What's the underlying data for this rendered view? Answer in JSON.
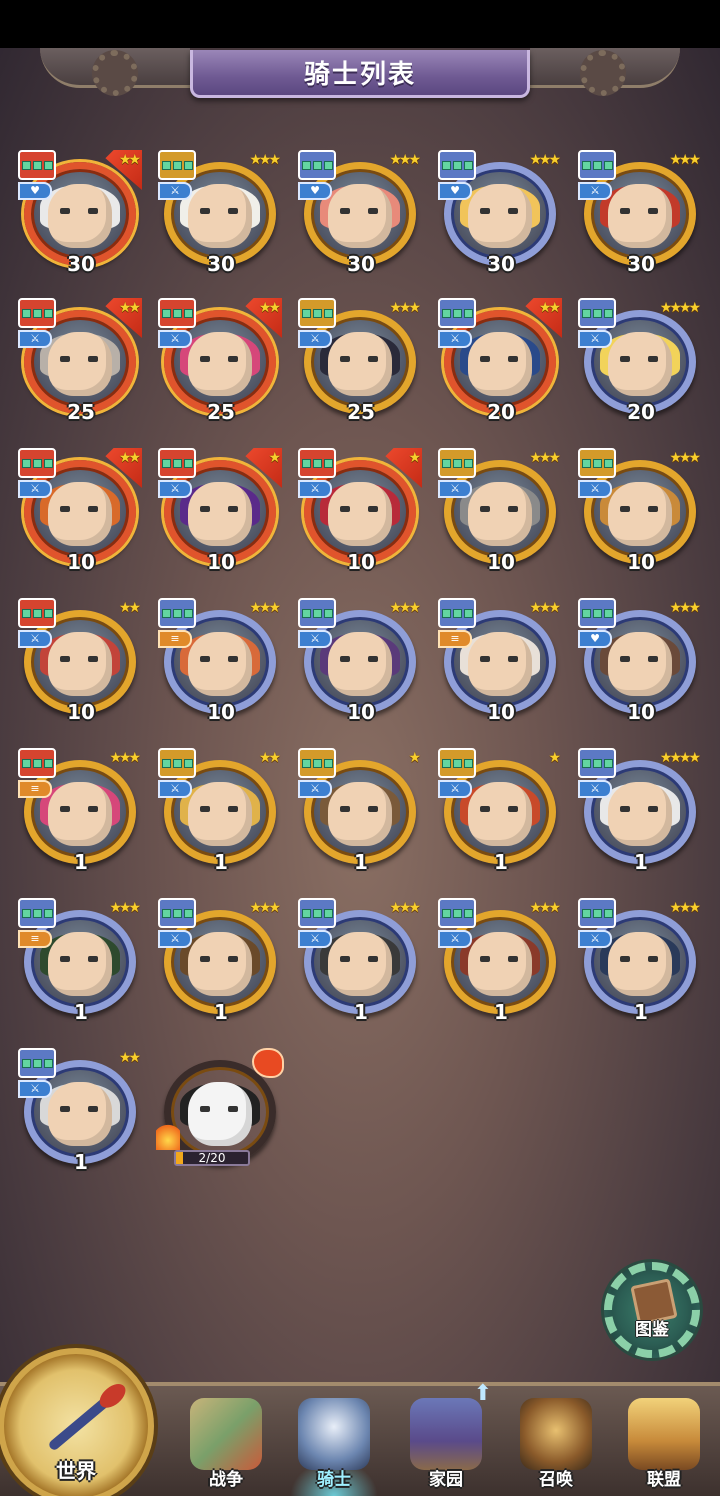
{
  "title": "骑士列表",
  "heroes": [
    {
      "level": "30",
      "frame": "red",
      "stars": 2,
      "class_color": "red",
      "role": "heart"
    },
    {
      "level": "30",
      "frame": "gold",
      "stars": 3,
      "class_color": "gold",
      "role": "sword"
    },
    {
      "level": "30",
      "frame": "gold",
      "stars": 3,
      "class_color": "blue",
      "role": "heart"
    },
    {
      "level": "30",
      "frame": "blue",
      "stars": 3,
      "class_color": "blue",
      "role": "heart"
    },
    {
      "level": "30",
      "frame": "gold",
      "stars": 3,
      "class_color": "blue",
      "role": "sword"
    },
    {
      "level": "25",
      "frame": "red",
      "stars": 2,
      "class_color": "red",
      "role": "sword"
    },
    {
      "level": "25",
      "frame": "red",
      "stars": 2,
      "class_color": "red",
      "role": "sword"
    },
    {
      "level": "25",
      "frame": "gold",
      "stars": 3,
      "class_color": "gold",
      "role": "sword"
    },
    {
      "level": "20",
      "frame": "red",
      "stars": 2,
      "class_color": "blue",
      "role": "sword"
    },
    {
      "level": "20",
      "frame": "blue",
      "stars": 4,
      "class_color": "blue",
      "role": "sword"
    },
    {
      "level": "10",
      "frame": "red",
      "stars": 2,
      "class_color": "red",
      "role": "sword"
    },
    {
      "level": "10",
      "frame": "red",
      "stars": 1,
      "class_color": "red",
      "role": "sword"
    },
    {
      "level": "10",
      "frame": "red",
      "stars": 1,
      "class_color": "red",
      "role": "sword"
    },
    {
      "level": "10",
      "frame": "gold",
      "stars": 3,
      "class_color": "gold",
      "role": "sword"
    },
    {
      "level": "10",
      "frame": "gold",
      "stars": 3,
      "class_color": "gold",
      "role": "sword"
    },
    {
      "level": "10",
      "frame": "gold",
      "stars": 2,
      "class_color": "red",
      "role": "sword"
    },
    {
      "level": "10",
      "frame": "blue",
      "stars": 3,
      "class_color": "blue",
      "role": "bars"
    },
    {
      "level": "10",
      "frame": "blue",
      "stars": 3,
      "class_color": "blue",
      "role": "sword"
    },
    {
      "level": "10",
      "frame": "blue",
      "stars": 3,
      "class_color": "blue",
      "role": "bars"
    },
    {
      "level": "10",
      "frame": "blue",
      "stars": 3,
      "class_color": "blue",
      "role": "heart"
    },
    {
      "level": "1",
      "frame": "gold",
      "stars": 3,
      "class_color": "red",
      "role": "bars"
    },
    {
      "level": "1",
      "frame": "gold",
      "stars": 2,
      "class_color": "gold",
      "role": "sword"
    },
    {
      "level": "1",
      "frame": "gold",
      "stars": 1,
      "class_color": "gold",
      "role": "sword"
    },
    {
      "level": "1",
      "frame": "gold",
      "stars": 1,
      "class_color": "gold",
      "role": "sword"
    },
    {
      "level": "1",
      "frame": "blue",
      "stars": 4,
      "class_color": "blue",
      "role": "sword"
    },
    {
      "level": "1",
      "frame": "blue",
      "stars": 3,
      "class_color": "blue",
      "role": "bars"
    },
    {
      "level": "1",
      "frame": "gold",
      "stars": 3,
      "class_color": "blue",
      "role": "sword"
    },
    {
      "level": "1",
      "frame": "blue",
      "stars": 3,
      "class_color": "blue",
      "role": "sword"
    },
    {
      "level": "1",
      "frame": "gold",
      "stars": 3,
      "class_color": "blue",
      "role": "sword"
    },
    {
      "level": "1",
      "frame": "blue",
      "stars": 3,
      "class_color": "blue",
      "role": "sword"
    },
    {
      "level": "1",
      "frame": "blue",
      "stars": 2,
      "class_color": "blue",
      "role": "sword"
    }
  ],
  "shard_hero": {
    "progress_text": "2/20",
    "progress": 0.1
  },
  "codex_label": "图鉴",
  "nav": {
    "world": "世界",
    "battle": "战争",
    "knights": "骑士",
    "home": "家园",
    "summon": "召唤",
    "alliance": "联盟"
  },
  "colors": {
    "frame_gold": "#e3a62c",
    "frame_red": "#e0542c",
    "frame_blue": "#8f9ed8",
    "star": "#f7cf2d"
  }
}
